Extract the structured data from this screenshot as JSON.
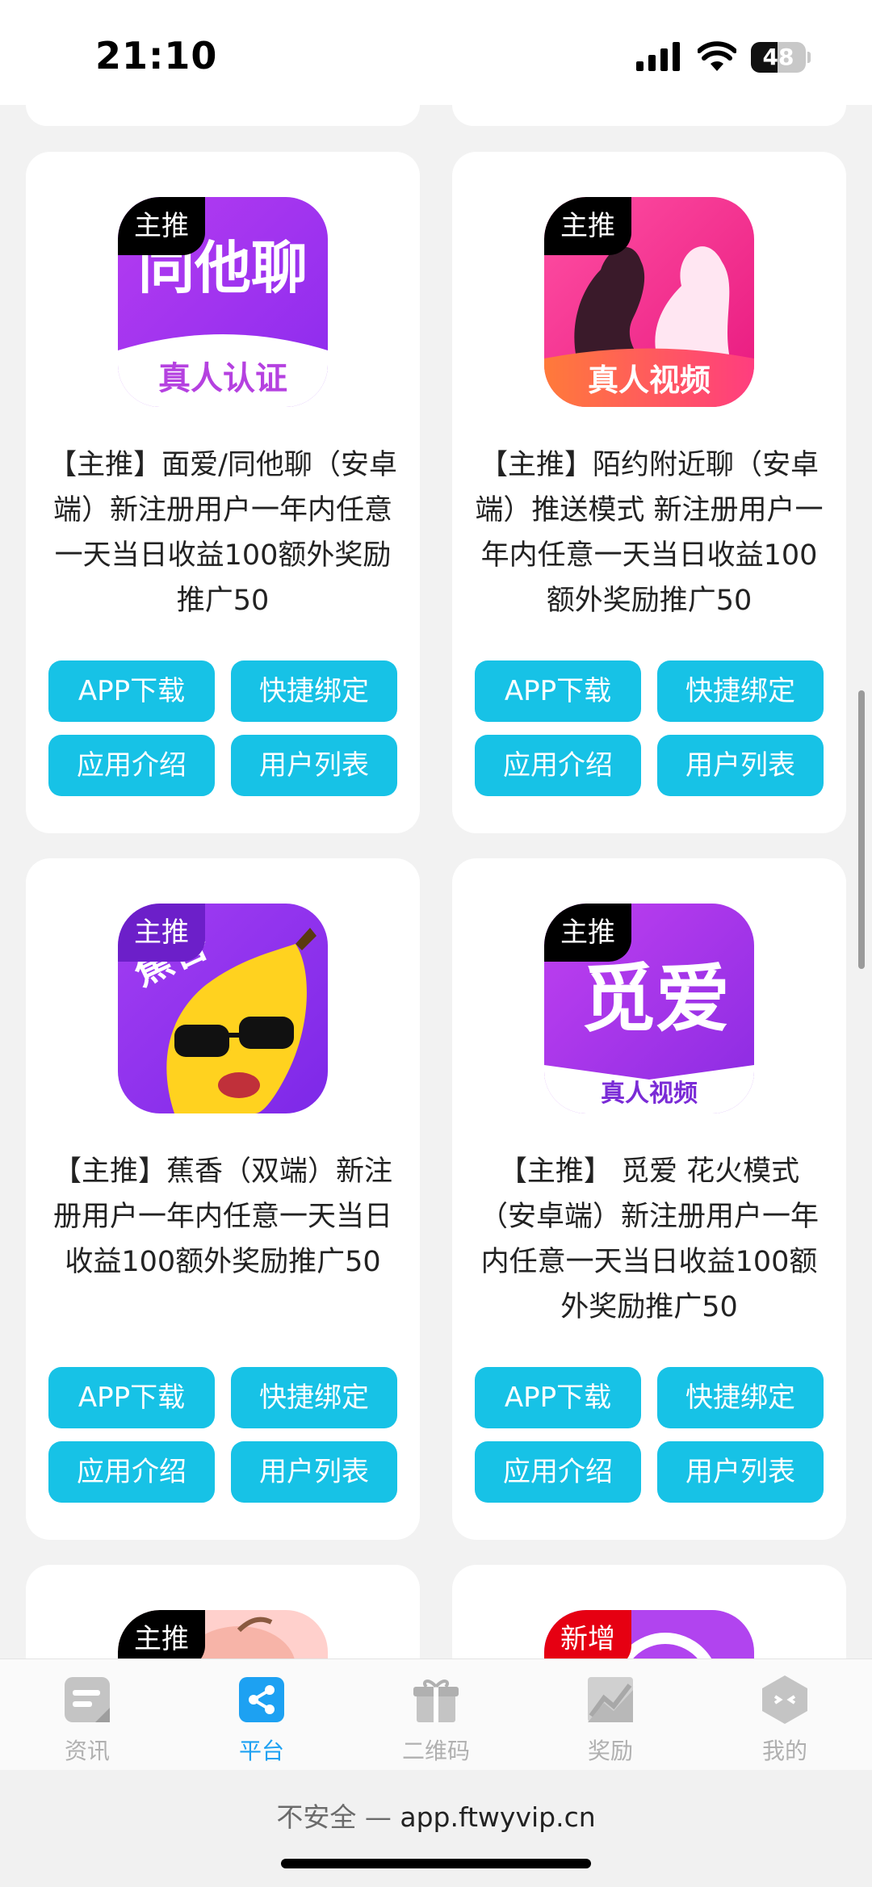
{
  "status_bar": {
    "time": "21:10",
    "battery_level": "48"
  },
  "cards": [
    {
      "tag": "主推",
      "icon": "tongtaliao-app-icon",
      "icon_text_main": "同他聊",
      "icon_text_sub": "真人认证",
      "title": "【主推】面爱/同他聊（安卓端）新注册用户一年内任意一天当日收益100额外奖励推广50"
    },
    {
      "tag": "主推",
      "icon": "moyue-app-icon",
      "icon_text_sub": "真人视频",
      "title": "【主推】陌约附近聊（安卓端）推送模式 新注册用户一年内任意一天当日收益100额外奖励推广50"
    },
    {
      "tag": "主推",
      "icon": "jiaoxiang-banana-app-icon",
      "icon_text_main": "蕉香",
      "title": "【主推】蕉香（双端）新注册用户一年内任意一天当日收益100额外奖励推广50"
    },
    {
      "tag": "主推",
      "icon": "miai-app-icon",
      "icon_text_main": "觅爱",
      "icon_text_sub": "真人视频",
      "title": "【主推】 觅爱 花火模式（安卓端）新注册用户一年内任意一天当日收益100额外奖励推广50"
    }
  ],
  "partial_cards": [
    {
      "tag": "主推"
    },
    {
      "tag": "新增"
    }
  ],
  "buttons": {
    "download": "APP下载",
    "bind": "快捷绑定",
    "intro": "应用介绍",
    "users": "用户列表"
  },
  "tabbar": [
    {
      "label": "资讯",
      "icon": "news-icon",
      "active": false
    },
    {
      "label": "平台",
      "icon": "share-icon",
      "active": true
    },
    {
      "label": "二维码",
      "icon": "gift-icon",
      "active": false
    },
    {
      "label": "奖励",
      "icon": "chart-icon",
      "active": false
    },
    {
      "label": "我的",
      "icon": "profile-hexagon-icon",
      "active": false
    }
  ],
  "browser": {
    "insecure_label": "不安全",
    "separator": " — ",
    "domain": "app.ftwyvip.cn"
  },
  "colors": {
    "button": "#17c2e6",
    "tab_active": "#1da1f2",
    "tag": "#000000",
    "tag_new": "#e60012"
  }
}
